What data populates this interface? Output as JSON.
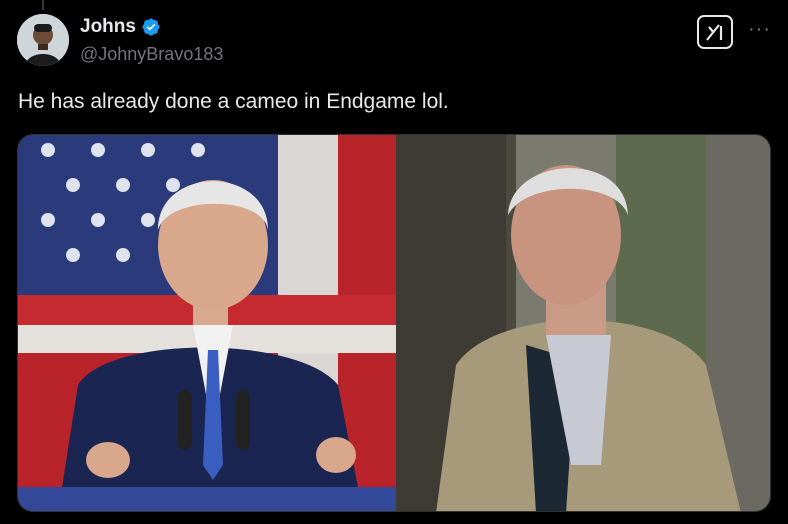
{
  "user": {
    "name": "Johns",
    "handle": "@JohnyBravo183",
    "verified": true,
    "avatar_icon": "avatar-person-icon"
  },
  "tweet": {
    "text": "He has already done a cameo in Endgame lol."
  },
  "actions": {
    "grok_icon": "grok-icon",
    "more_label": "···"
  },
  "media": {
    "left_image": "photo-politician-at-podium",
    "right_image": "photo-elderly-man-in-jacket"
  },
  "colors": {
    "background": "#000000",
    "text": "#e7e9ea",
    "secondary": "#71767b",
    "verified": "#1d9bf0"
  }
}
